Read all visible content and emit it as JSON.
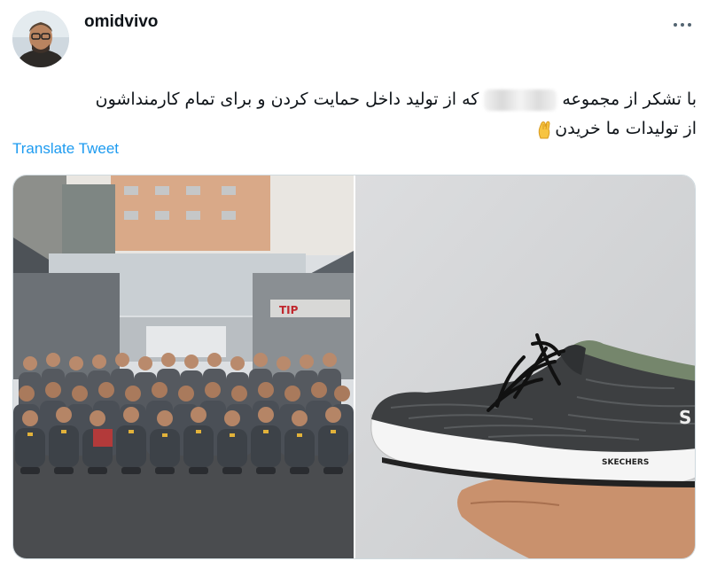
{
  "user": {
    "username": "omidvivo",
    "avatar_icon": "user-avatar-photo"
  },
  "header": {
    "more_icon": "more-horizontal-icon"
  },
  "tweet": {
    "line1_prefix": "با تشکر از مجموعه",
    "line1_suffix": "که از تولید داخل حمایت کردن و برای تمام کارمنداشون",
    "line2": "از تولیدات ما خریدن",
    "emoji_icon": "pinched-fingers-emoji",
    "translate_label": "Translate Tweet"
  },
  "media": {
    "photo1_name": "staff-group-photo",
    "photo2_name": "sneaker-photo",
    "shoe_brand_text": "SKECHERS",
    "colors": {
      "link": "#1d9bf0",
      "text": "#0f1419",
      "secondary": "#536471",
      "border": "#cfd9de"
    }
  }
}
